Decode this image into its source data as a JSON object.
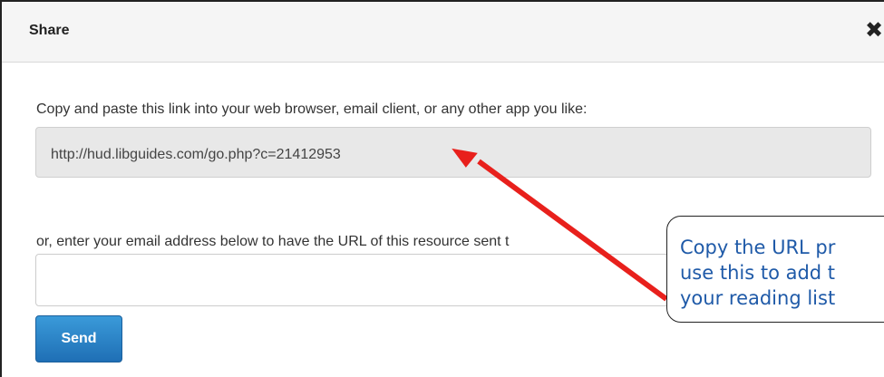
{
  "dialog": {
    "title": "Share",
    "close_symbol": "✖",
    "instruction": "Copy and paste this link into your web browser, email client, or any other app you like:",
    "url": "http://hud.libguides.com/go.php?c=21412953",
    "email_prompt": "or, enter your email address below to have the URL of this resource sent t",
    "email_value": "",
    "send_label": "Send"
  },
  "annotation": {
    "line1": "Copy the URL pr",
    "line2": "use this to add t",
    "line3": "your reading list",
    "arrow_color": "#e8201c",
    "text_color": "#1f5aa8"
  },
  "colors": {
    "header_bg": "#f5f5f5",
    "url_box_bg": "#e8e8e8",
    "send_button": "#1f6fb5"
  }
}
